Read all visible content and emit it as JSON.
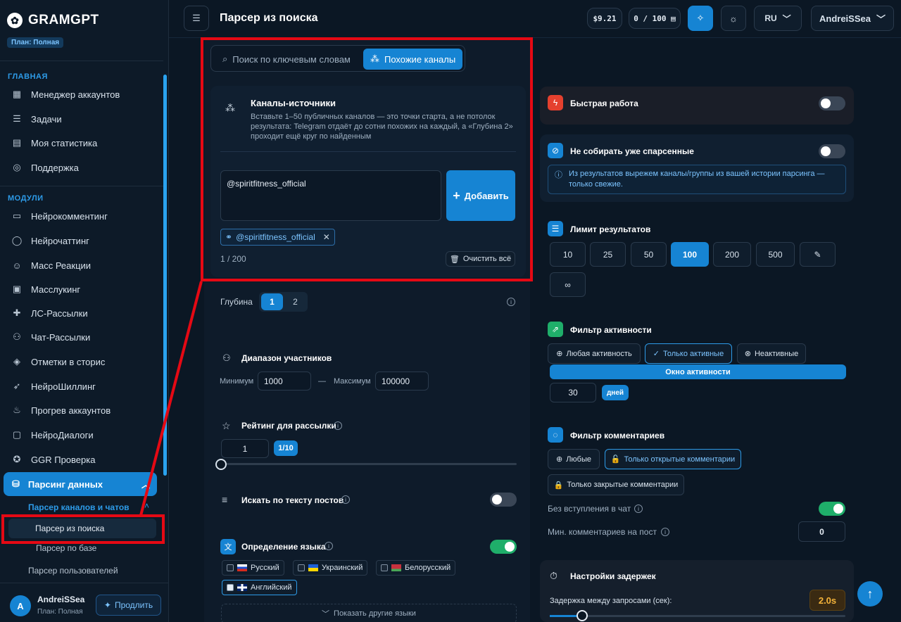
{
  "app": {
    "logo_mark": "✿",
    "name": "GRAMGPT",
    "plan_badge": "План: Полная"
  },
  "sidebar": {
    "section_main": "ГЛАВНАЯ",
    "main_items": [
      {
        "label": "Менеджер аккаунтов",
        "icon": "grid-icon"
      },
      {
        "label": "Задачи",
        "icon": "list-icon"
      },
      {
        "label": "Моя статистика",
        "icon": "chart-icon"
      },
      {
        "label": "Поддержка",
        "icon": "lifebuoy-icon"
      }
    ],
    "section_modules": "МОДУЛИ",
    "module_items": [
      {
        "label": "Нейрокомментинг"
      },
      {
        "label": "Нейрочаттинг"
      },
      {
        "label": "Масс Реакции"
      },
      {
        "label": "Масслукинг"
      },
      {
        "label": "ЛС-Рассылки"
      },
      {
        "label": "Чат-Рассылки"
      },
      {
        "label": "Отметки в сторис"
      },
      {
        "label": "НейроШиллинг"
      },
      {
        "label": "Прогрев аккаунтов"
      },
      {
        "label": "НейроДиалоги"
      },
      {
        "label": "GGR Проверка"
      }
    ],
    "active_item": "Парсинг данных",
    "sub_group": "Парсер каналов и чатов",
    "sub_active": "Парсер из поиска",
    "sub_item": "Парсер по базе",
    "sub_item2": "Парсер пользователей",
    "user": {
      "initial": "A",
      "name": "AndreiSSea",
      "plan": "План: Полная",
      "extend": "Продлить"
    }
  },
  "header": {
    "title": "Парсер из поиска",
    "balance": "$9.21",
    "quota": "0 / 100",
    "lang": "RU",
    "username": "AndreiSSea"
  },
  "tabs": {
    "keyword": "Поиск по ключевым словам",
    "similar": "Похожие каналы"
  },
  "sources": {
    "title": "Каналы-источники",
    "desc_1": "Вставьте 1–50 публичных каналов — это точки старта, а не потолок",
    "desc_2": "результата: Telegram отдаёт до сотни похожих на каждый, а «Глубина 2»",
    "desc_3": "проходит ещё круг по найденным",
    "input_value": "@spiritfitness_official",
    "add_button": "Добавить",
    "tag": "@spiritfitness_official",
    "count": "1 / 200",
    "clear": "Очистить всё"
  },
  "depth": {
    "label": "Глубина",
    "opt1": "1",
    "opt2": "2"
  },
  "participants": {
    "title": "Диапазон участников",
    "min_label": "Минимум",
    "min_value": "1000",
    "dash": "—",
    "max_label": "Максимум",
    "max_value": "100000"
  },
  "rating": {
    "title": "Рейтинг для рассылки",
    "value": "1",
    "unit": "1/10",
    "level": 0
  },
  "post_text": {
    "title": "Искать по тексту постов",
    "enabled": false
  },
  "language": {
    "title": "Определение языка",
    "enabled": true,
    "options": [
      {
        "label": "Русский",
        "checked": false
      },
      {
        "label": "Украинский",
        "checked": false
      },
      {
        "label": "Белорусский",
        "checked": false
      },
      {
        "label": "Английский",
        "checked": true
      }
    ],
    "more": "Показать другие языки"
  },
  "right": {
    "fast": {
      "title": "Быстрая работа",
      "enabled": false
    },
    "skip": {
      "title": "Не собирать уже спарсенные",
      "enabled": false,
      "info_1": "Из результатов вырежем каналы/группы из вашей истории парсинга —",
      "info_2": "только свежие."
    },
    "limit": {
      "title": "Лимит результатов",
      "options": [
        "10",
        "25",
        "50",
        "100",
        "200",
        "500"
      ],
      "selected": "100",
      "infinite": "∞"
    },
    "activity": {
      "title": "Фильтр активности",
      "any": "Любая активность",
      "active": "Только активные",
      "inactive": "Неактивные",
      "window": "Окно активности",
      "days_value": "30",
      "days_unit": "дней"
    },
    "comments": {
      "title": "Фильтр комментариев",
      "any": "Любые",
      "open": "Только открытые комментарии",
      "closed": "Только закрытые комментарии",
      "no_join": "Без вступления в чат",
      "no_join_enabled": true,
      "min_label": "Мин. комментариев на пост",
      "min_value": "0"
    },
    "delays": {
      "title": "Настройки задержек",
      "between": "Задержка между запросами (сек):",
      "value": "2.0s"
    }
  },
  "colors": {
    "accent": "#1684d3",
    "highlight": "#e50914",
    "success": "#1fae6a"
  }
}
